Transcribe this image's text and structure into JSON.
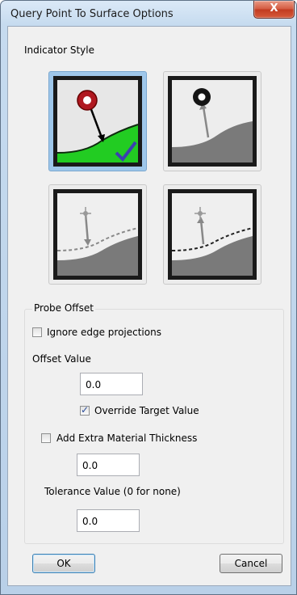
{
  "window": {
    "title": "Query Point To Surface Options",
    "close_label": "X"
  },
  "indicator": {
    "label": "Indicator Style",
    "options": [
      {
        "name": "style-1",
        "selected": true
      },
      {
        "name": "style-2",
        "selected": false
      },
      {
        "name": "style-3",
        "selected": false
      },
      {
        "name": "style-4",
        "selected": false
      }
    ]
  },
  "probe": {
    "legend": "Probe Offset",
    "ignore_edge_label": "Ignore edge projections",
    "ignore_edge_checked": false,
    "offset_label": "Offset Value",
    "offset_value": "0.0",
    "override_label": "Override Target Value",
    "override_checked": true
  },
  "extra": {
    "label": "Add Extra Material Thickness",
    "checked": false,
    "value": "0.0"
  },
  "tolerance": {
    "label": "Tolerance Value (0 for none)",
    "value": "0.0"
  },
  "buttons": {
    "ok": "OK",
    "cancel": "Cancel"
  },
  "colors": {
    "selected_tile": "#9fc7ea",
    "green_fill": "#22cc22",
    "red_ball": "#b01820",
    "check_blue": "#3b3fb0"
  }
}
